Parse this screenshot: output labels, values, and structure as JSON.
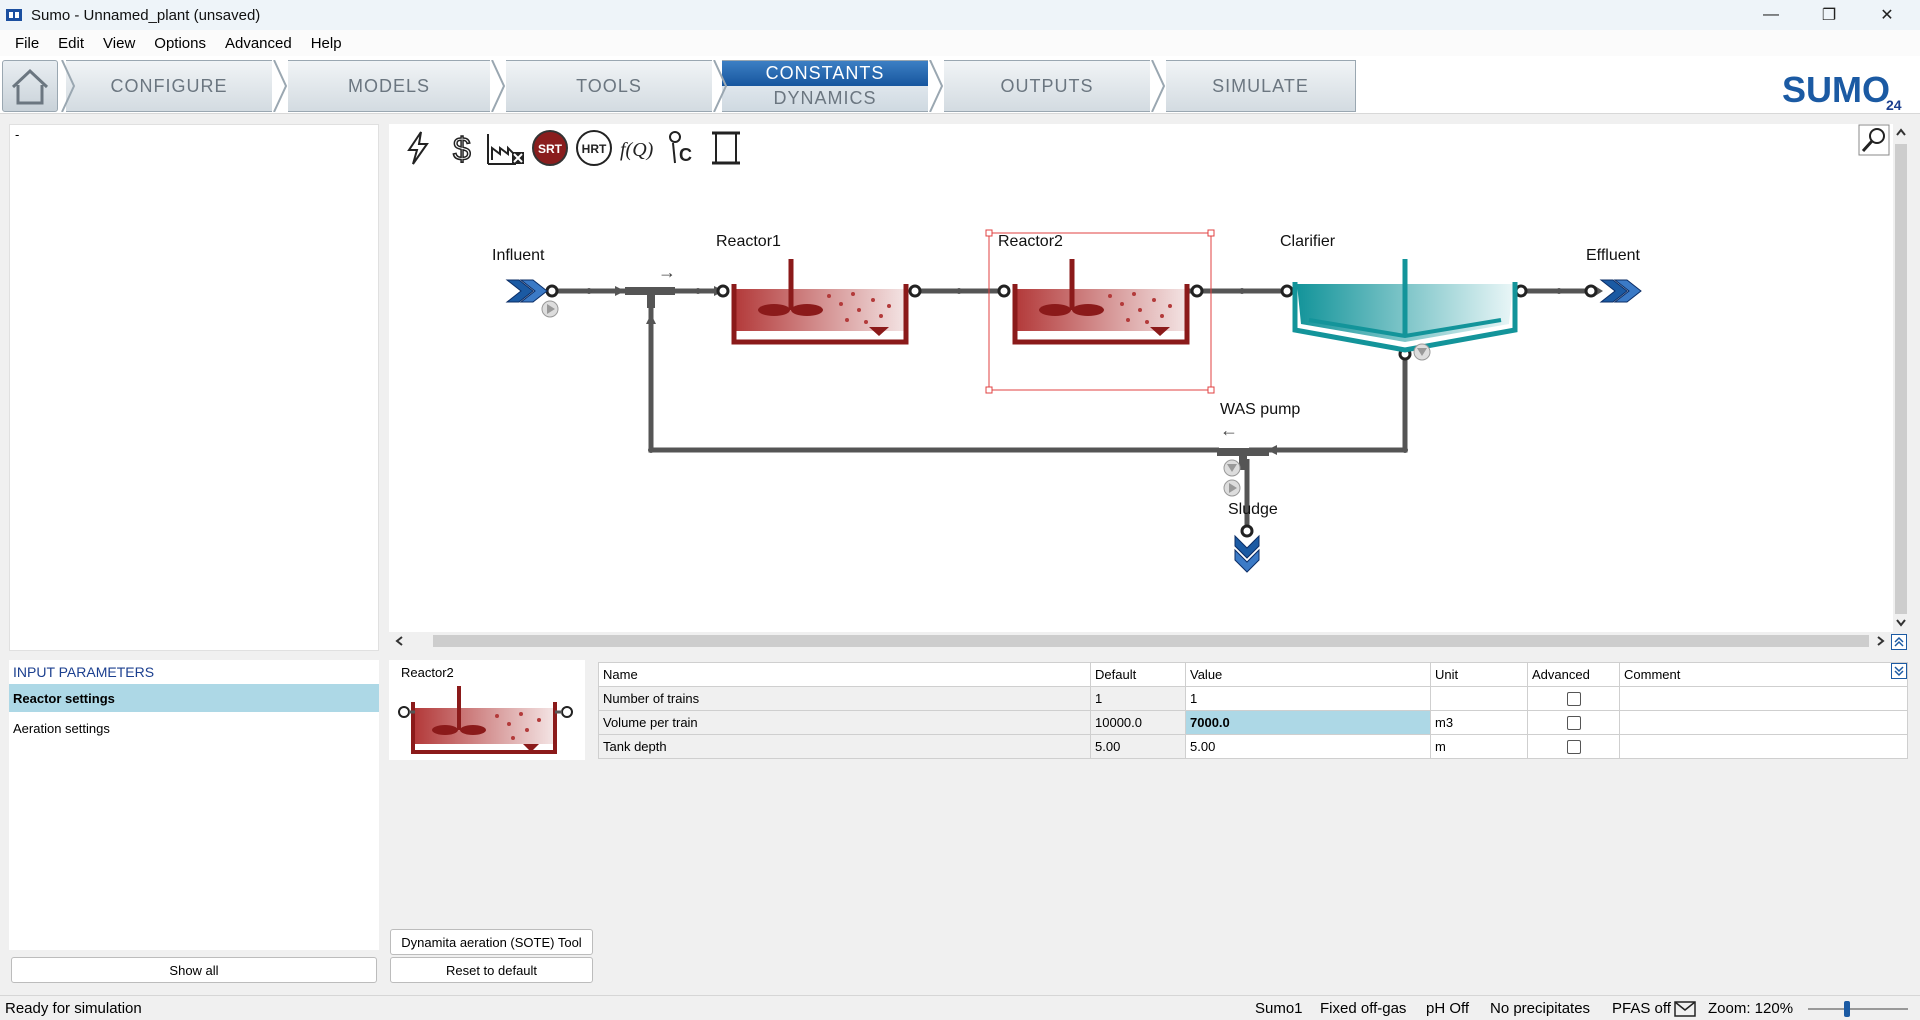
{
  "window": {
    "title": "Sumo - Unnamed_plant (unsaved)"
  },
  "menu": [
    "File",
    "Edit",
    "View",
    "Options",
    "Advanced",
    "Help"
  ],
  "nav": {
    "tabs": [
      "CONFIGURE",
      "MODELS",
      "TOOLS",
      "OUTPUTS",
      "SIMULATE"
    ],
    "active_top": "CONSTANTS",
    "active_bottom": "DYNAMICS",
    "logo_text": "SUMO",
    "logo_version": "24"
  },
  "left_panel": {
    "placeholder": "-"
  },
  "toolbar_icons": [
    "lightning-icon",
    "dollar-icon",
    "plant-x-icon",
    "srt-icon",
    "hrt-icon",
    "fq-icon",
    "pc-icon",
    "scroll-icon"
  ],
  "toolbar_text": {
    "srt": "SRT",
    "hrt": "HRT",
    "fq": "f(Q)",
    "pc": "C"
  },
  "flowsheet": {
    "units": {
      "influent": "Influent",
      "reactor1": "Reactor1",
      "reactor2": "Reactor2",
      "clarifier": "Clarifier",
      "effluent": "Effluent",
      "was_pump": "WAS pump",
      "sludge": "Sludge"
    },
    "arrows": {
      "right": "→",
      "left": "←"
    }
  },
  "input_parameters": {
    "header": "INPUT PARAMETERS",
    "items": [
      "Reactor settings",
      "Aeration settings"
    ],
    "show_all": "Show all"
  },
  "detail": {
    "unit_name": "Reactor2",
    "sote_button": "Dynamita aeration (SOTE) Tool",
    "reset_button": "Reset to default",
    "columns": [
      "Name",
      "Default",
      "Value",
      "Unit",
      "Advanced",
      "Comment"
    ],
    "rows": [
      {
        "name": "Number of trains",
        "default": "1",
        "value": "1",
        "unit": "",
        "advanced": false,
        "comment": ""
      },
      {
        "name": "Volume per train",
        "default": "10000.0",
        "value": "7000.0",
        "unit": "m3",
        "advanced": false,
        "comment": ""
      },
      {
        "name": "Tank depth",
        "default": "5.00",
        "value": "5.00",
        "unit": "m",
        "advanced": false,
        "comment": ""
      }
    ]
  },
  "status": {
    "left": "Ready for simulation",
    "model": "Sumo1",
    "offgas": "Fixed off-gas",
    "ph": "pH Off",
    "precip": "No precipitates",
    "pfas": "PFAS off",
    "zoom": "Zoom: 120%"
  },
  "colors": {
    "reactor": "#8b1a1a",
    "clarifier": "#13949a",
    "pipe": "#555555",
    "selection": "#e04040",
    "accent": "#1b5aa3"
  }
}
